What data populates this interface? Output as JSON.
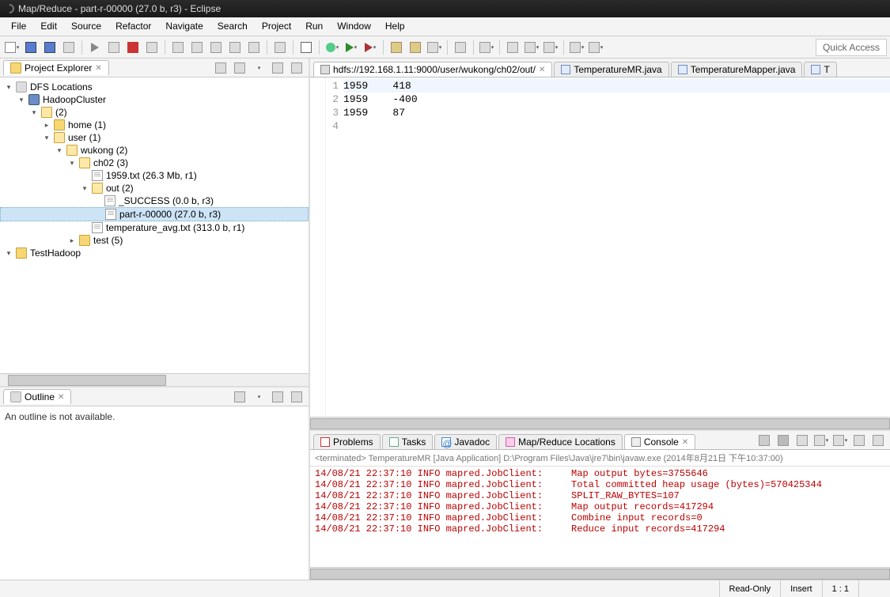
{
  "window": {
    "title": "Map/Reduce - part-r-00000 (27.0 b, r3) - Eclipse"
  },
  "menu": [
    "File",
    "Edit",
    "Source",
    "Refactor",
    "Navigate",
    "Search",
    "Project",
    "Run",
    "Window",
    "Help"
  ],
  "quick_access": "Quick Access",
  "project_explorer": {
    "title": "Project Explorer",
    "tree": {
      "dfs": "DFS Locations",
      "cluster": "HadoopCluster",
      "root": "(2)",
      "home": "home (1)",
      "user": "user (1)",
      "wukong": "wukong (2)",
      "ch02": "ch02 (3)",
      "f1959": "1959.txt (26.3 Mb, r1)",
      "out": "out (2)",
      "success": "_SUCCESS (0.0 b, r3)",
      "part": "part-r-00000 (27.0 b, r3)",
      "tempavg": "temperature_avg.txt (313.0 b, r1)",
      "test": "test (5)",
      "testhadoop": "TestHadoop"
    }
  },
  "outline": {
    "title": "Outline",
    "msg": "An outline is not available."
  },
  "editor": {
    "tabs": [
      {
        "label": "hdfs://192.168.1.11:9000/user/wukong/ch02/out/",
        "icon": "file",
        "active": true,
        "close": true
      },
      {
        "label": "TemperatureMR.java",
        "icon": "java",
        "close": false
      },
      {
        "label": "TemperatureMapper.java",
        "icon": "java",
        "close": false
      },
      {
        "label": "T",
        "icon": "java",
        "close": false
      }
    ],
    "lines": [
      "1959    418",
      "1959    -400",
      "1959    87",
      ""
    ],
    "gutter": [
      "1",
      "2",
      "3",
      "4"
    ]
  },
  "bottom": {
    "tabs": [
      "Problems",
      "Tasks",
      "Javadoc",
      "Map/Reduce Locations",
      "Console"
    ],
    "active_idx": 4,
    "console_desc": "<terminated> TemperatureMR [Java Application] D:\\Program Files\\Java\\jre7\\bin\\javaw.exe (2014年8月21日 下午10:37:00)",
    "console_lines": [
      "14/08/21 22:37:10 INFO mapred.JobClient:     Map output bytes=3755646",
      "14/08/21 22:37:10 INFO mapred.JobClient:     Total committed heap usage (bytes)=570425344",
      "14/08/21 22:37:10 INFO mapred.JobClient:     SPLIT_RAW_BYTES=107",
      "14/08/21 22:37:10 INFO mapred.JobClient:     Map output records=417294",
      "14/08/21 22:37:10 INFO mapred.JobClient:     Combine input records=0",
      "14/08/21 22:37:10 INFO mapred.JobClient:     Reduce input records=417294"
    ]
  },
  "status": {
    "readonly": "Read-Only",
    "insert": "Insert",
    "pos": "1 : 1"
  }
}
